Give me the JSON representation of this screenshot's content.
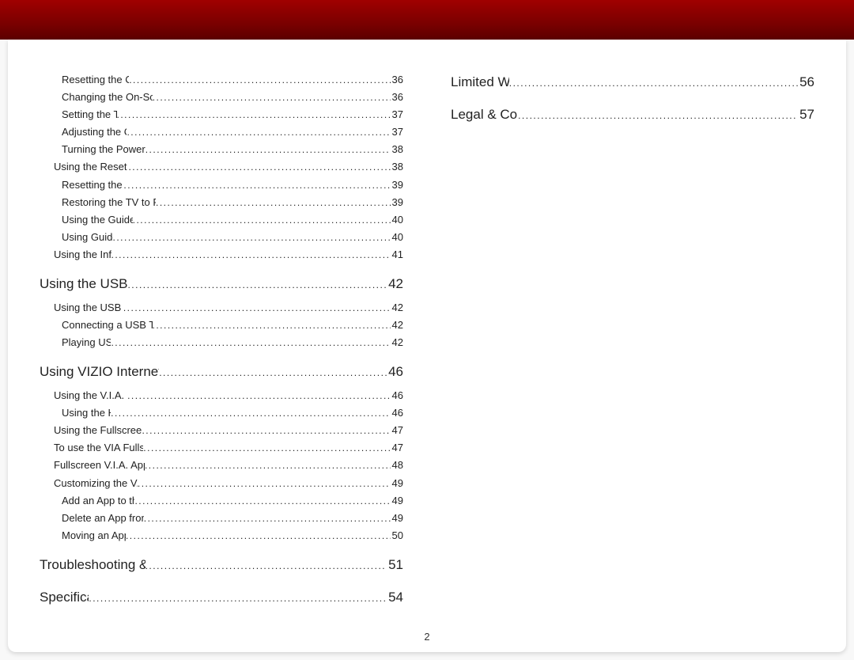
{
  "page_number": "2",
  "left_column": [
    {
      "level": 3,
      "title": "Resetting the Content Locks",
      "page": "36"
    },
    {
      "level": 3,
      "title": "Changing the On-Screen Menu Language",
      "page": "36"
    },
    {
      "level": 3,
      "title": "Setting the Time Zone",
      "page": "37"
    },
    {
      "level": 3,
      "title": "Adjusting the CEC Settings",
      "page": "37"
    },
    {
      "level": 3,
      "title": "Turning the Power Indicator On or Off",
      "page": "38"
    },
    {
      "level": 2,
      "title": "Using the Reset & Admin Menu",
      "page": "38"
    },
    {
      "level": 3,
      "title": "Resetting the TV Settings",
      "page": "39"
    },
    {
      "level": 3,
      "title": "Restoring the TV to Factory Default Settings",
      "page": "39"
    },
    {
      "level": 3,
      "title": "Using the Guided Setup Menu",
      "page": "40"
    },
    {
      "level": 3,
      "title": "Using Guided Setup",
      "page": "40"
    },
    {
      "level": 2,
      "title": "Using the Info Window",
      "page": "41"
    },
    {
      "level": 1,
      "title": "Using the USB Media Player",
      "page": "42"
    },
    {
      "level": 2,
      "title": "Using the USB Media Player",
      "page": "42"
    },
    {
      "level": 3,
      "title": "Connecting a USB Thumb Drive to the TV",
      "page": "42"
    },
    {
      "level": 3,
      "title": "Playing USB Media",
      "page": "42"
    },
    {
      "level": 1,
      "title": "Using VIZIO Internet Apps Plus™ (VIA Plus)",
      "page": "46"
    },
    {
      "level": 2,
      "title": "Using the V.I.A. Plus App Dock",
      "page": "46"
    },
    {
      "level": 3,
      "title": "Using the Hot Keys",
      "page": "46"
    },
    {
      "level": 2,
      "title": "Using the Fullscreen VIA Apps Window",
      "page": "47"
    },
    {
      "level": 2,
      "title": "To use the VIA Fullscreen apps window:",
      "page": "47"
    },
    {
      "level": 2,
      "title": "Fullscreen V.I.A. Apps Window Overview",
      "page": "48"
    },
    {
      "level": 2,
      "title": "Customizing the V.I.A. Apps Window",
      "page": "49"
    },
    {
      "level": 3,
      "title": "Add an App to the My Apps Tab",
      "page": "49"
    },
    {
      "level": 3,
      "title": "Delete an App from the My Apps Tab",
      "page": "49"
    },
    {
      "level": 3,
      "title": "Moving an App in My Apps",
      "page": "50"
    },
    {
      "level": 1,
      "title": "Troubleshooting & Technical Support",
      "page": "51"
    },
    {
      "level": 1,
      "title": "Specifications",
      "page": "54"
    }
  ],
  "right_column": [
    {
      "level": 1,
      "title": "Limited Warranty",
      "page": "56"
    },
    {
      "level": 1,
      "title": "Legal & Compliance",
      "page": "57"
    }
  ]
}
